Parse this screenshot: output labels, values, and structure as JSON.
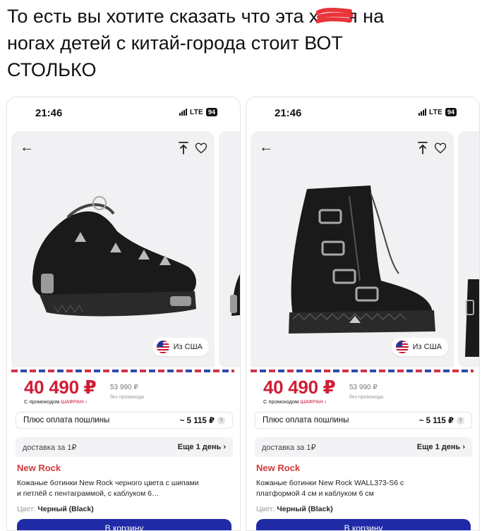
{
  "caption": {
    "line1_pre": "То есть вы хотите сказать что эта х",
    "line1_post": "я на",
    "line2": "ногах детей с китай-города стоит ВОТ",
    "line3": "СТОЛЬКО"
  },
  "colors": {
    "price_red": "#d21d36",
    "brand_red": "#d23a3a",
    "cart_blue": "#1f2aa6",
    "censor": "#e8343a"
  },
  "phones": [
    {
      "status": {
        "time": "21:46",
        "network": "LTE",
        "battery": "94"
      },
      "origin_badge": "Из США",
      "price": "40 490 ₽",
      "promo_prefix": "С промокодом",
      "promo_code": "ШАФРАН ›",
      "old_price": "53 990 ₽",
      "old_price_note": "без промокода",
      "duty_label": "Плюс оплата пошлины",
      "duty_amount": "~ 5 115 ₽",
      "delivery_label": "доставка за 1₽",
      "delivery_when": "Еще 1 день ›",
      "brand": "New Rock",
      "title": "Кожаные ботинки New Rock черного цвета с шипами и петлёй с пентаграммой, с каблуком 6…",
      "color_label": "Цвет:",
      "color_value": "Черный (Black)",
      "cart_button": "В корзину"
    },
    {
      "status": {
        "time": "21:46",
        "network": "LTE",
        "battery": "94"
      },
      "origin_badge": "Из США",
      "price": "40 490 ₽",
      "promo_prefix": "С промокодом",
      "promo_code": "ШАФРАН ›",
      "old_price": "53 990 ₽",
      "old_price_note": "без промокода",
      "duty_label": "Плюс оплата пошлины",
      "duty_amount": "~ 5 115 ₽",
      "delivery_label": "доставка за 1₽",
      "delivery_when": "Еще 1 день ›",
      "brand": "New Rock",
      "title": "Кожаные ботинки New Rock WALL373-S6 с платформой 4 см и каблуком 6 см",
      "color_label": "Цвет:",
      "color_value": "Черный (Black)",
      "cart_button": "В корзину"
    }
  ]
}
